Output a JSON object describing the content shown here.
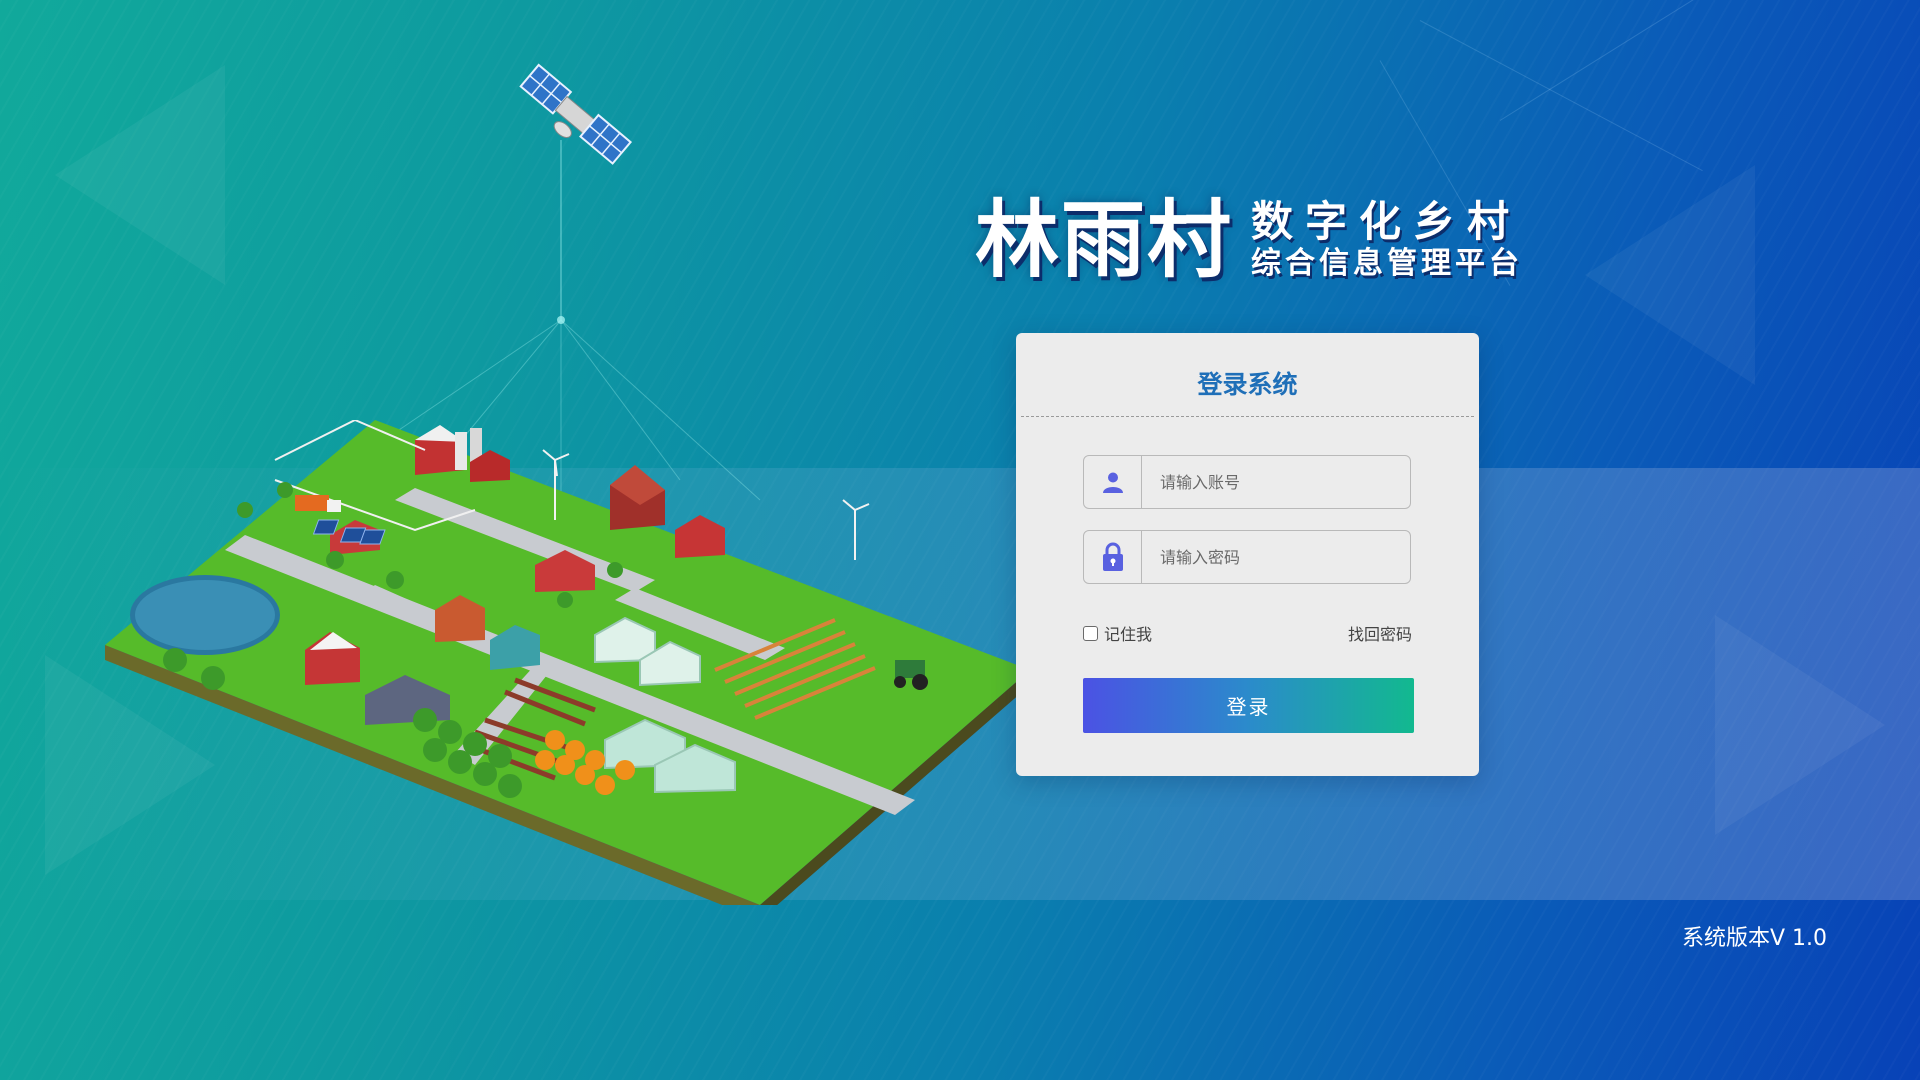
{
  "header": {
    "title_main": "林雨村",
    "title_sub1": "数字化乡村",
    "title_sub2": "综合信息管理平台"
  },
  "login": {
    "title": "登录系统",
    "username": {
      "placeholder": "请输入账号",
      "value": "",
      "icon": "user-icon"
    },
    "password": {
      "placeholder": "请输入密码",
      "value": "",
      "icon": "lock-icon"
    },
    "remember_label": "记住我",
    "remember_checked": false,
    "forgot_label": "找回密码",
    "submit_label": "登录"
  },
  "footer": {
    "version": "系统版本V 1.0"
  },
  "colors": {
    "accent": "#5961e0",
    "title_blue": "#1f6fb8",
    "button_start": "#4b52e4",
    "button_end": "#12b98f"
  },
  "illustration": {
    "satellite": "satellite-icon",
    "farm": "isometric-farm-illustration"
  }
}
